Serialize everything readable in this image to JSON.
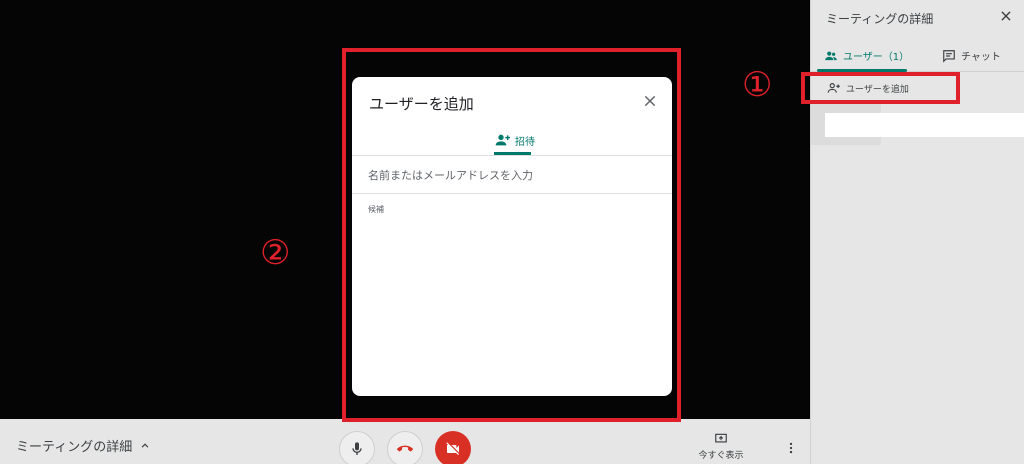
{
  "bottombar": {
    "meeting_details_label": "ミーティングの詳細",
    "present_label": "今すぐ表示"
  },
  "panel": {
    "title": "ミーティングの詳細",
    "tab_users_label": "ユーザー（1）",
    "tab_chat_label": "チャット",
    "add_user_label": "ユーザーを追加"
  },
  "dialog": {
    "title": "ユーザーを追加",
    "tab_invite_label": "招待",
    "search_placeholder": "名前またはメールアドレスを入力",
    "candidates_label": "候補"
  },
  "annotations": {
    "marker_1": "①",
    "marker_2": "②"
  },
  "colors": {
    "accent": "#00796b",
    "annotation": "#e0202a",
    "hangup": "#d93025"
  }
}
